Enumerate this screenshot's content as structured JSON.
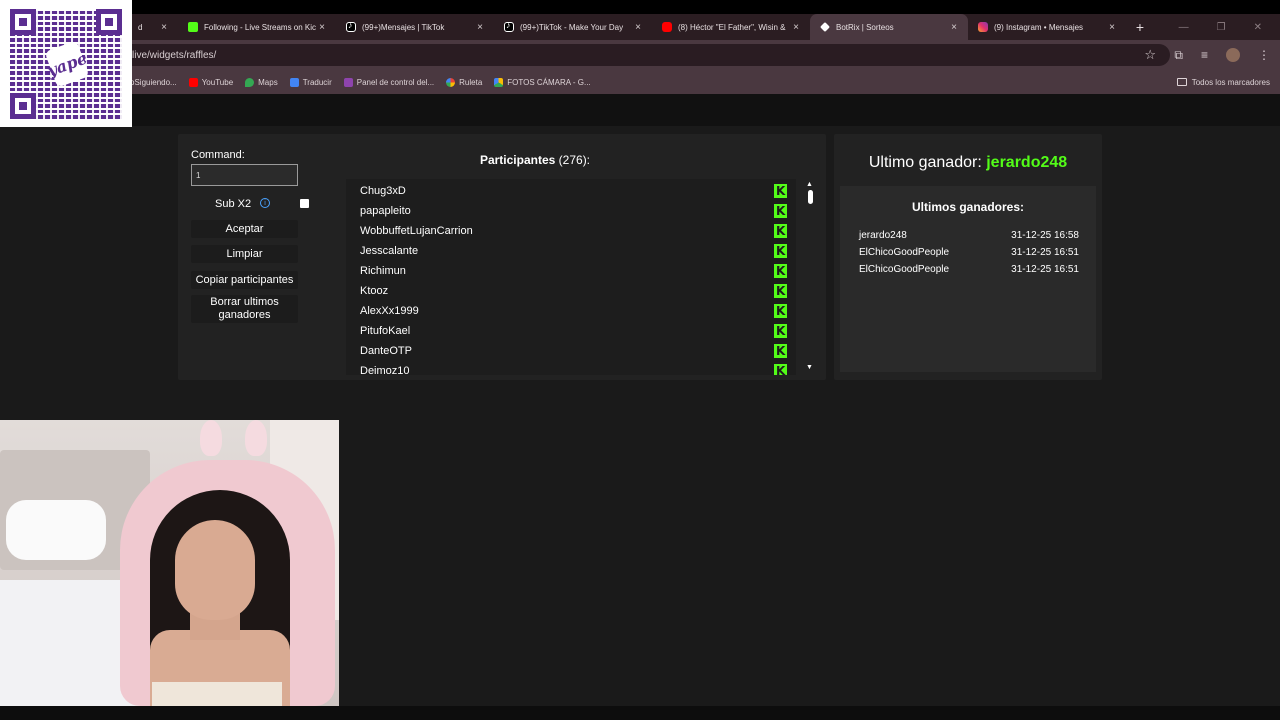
{
  "browser": {
    "tabs": [
      {
        "title": "d",
        "icon": "kick-icon"
      },
      {
        "title": "Following - Live Streams on Kick",
        "icon": "kick-icon"
      },
      {
        "title": "(99+)Mensajes | TikTok",
        "icon": "tiktok-icon"
      },
      {
        "title": "(99+)TikTok - Make Your Day",
        "icon": "tiktok-icon"
      },
      {
        "title": "(8) Héctor \"El Father\", Wisin &",
        "icon": "youtube-icon"
      },
      {
        "title": "BotRix | Sorteos",
        "icon": "botrix-icon",
        "active": true
      },
      {
        "title": "(9) Instagram • Mensajes",
        "icon": "instagram-icon"
      }
    ],
    "close_glyph": "×",
    "newtab_glyph": "+",
    "url": "live/widgets/raffles/",
    "bookmarks": [
      {
        "label": "oSiguiendo..."
      },
      {
        "label": "YouTube"
      },
      {
        "label": "Maps"
      },
      {
        "label": "Traducir"
      },
      {
        "label": "Panel de control del..."
      },
      {
        "label": "Ruleta"
      },
      {
        "label": "FOTOS CÁMARA - G..."
      }
    ],
    "all_bookmarks": "Todos los marcadores"
  },
  "qr": {
    "brand": "yape"
  },
  "raffle": {
    "command_label": "Command:",
    "command_value": "1",
    "sub_label": "Sub X2",
    "info_glyph": "i",
    "buttons": {
      "accept": "Aceptar",
      "clear": "Limpiar",
      "copy": "Copiar participantes",
      "delete_winners": "Borrar ultimos ganadores"
    },
    "participants_title": "Participantes",
    "participants_count": "(276):",
    "participants": [
      "Chug3xD",
      "papapleito",
      "WobbuffetLujanCarrion",
      "Jesscalante",
      "Richimun",
      "Ktooz",
      "AlexXx1999",
      "PitufoKael",
      "DanteOTP",
      "Deimoz10"
    ],
    "last_winner_label": "Ultimo ganador:",
    "last_winner_name": "jerardo248",
    "last_winners_title": "Ultimos ganadores:",
    "last_winners": [
      {
        "name": "jerardo248",
        "date": "31-12-25 16:58"
      },
      {
        "name": "ElChicoGoodPeople",
        "date": "31-12-25 16:51"
      },
      {
        "name": "ElChicoGoodPeople",
        "date": "31-12-25 16:51"
      }
    ]
  },
  "colors": {
    "kick_green": "#53fc18",
    "tab_active": "#4a3840",
    "panel": "#222222"
  }
}
